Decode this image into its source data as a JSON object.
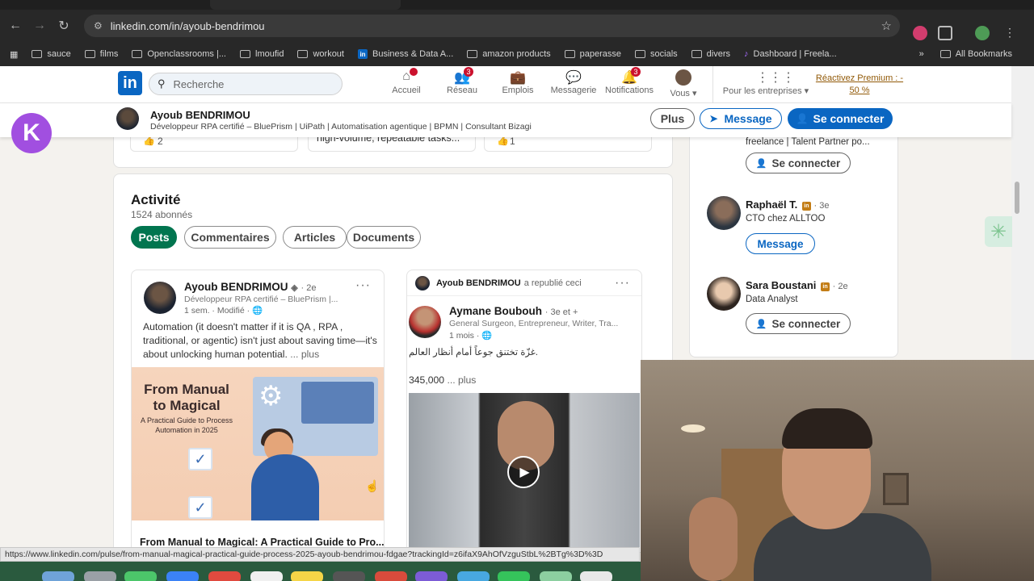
{
  "browser": {
    "url": "linkedin.com/in/ayoub-bendrimou",
    "bookmarks": [
      "sauce",
      "films",
      "Openclassrooms |...",
      "lmoufid",
      "workout",
      "Business & Data A...",
      "amazon products",
      "paperasse",
      "socials",
      "divers",
      "Dashboard | Freela..."
    ],
    "all_bookmarks": "All Bookmarks",
    "status_url": "https://www.linkedin.com/pulse/from-manual-magical-practical-guide-process-2025-ayoub-bendrimou-fdgae?trackingId=z6ifaX9AhOfVzguStbL%2BTg%3D%3D"
  },
  "header": {
    "logo": "in",
    "search_placeholder": "Recherche",
    "nav": [
      {
        "label": "Accueil",
        "badge": ""
      },
      {
        "label": "Réseau",
        "badge": "3"
      },
      {
        "label": "Emplois",
        "badge": ""
      },
      {
        "label": "Messagerie",
        "badge": ""
      },
      {
        "label": "Notifications",
        "badge": "3"
      },
      {
        "label": "Vous ▾",
        "badge": ""
      }
    ],
    "business": "Pour les entreprises ▾",
    "premium_line1": "Réactivez Premium : -",
    "premium_line2": "50 %"
  },
  "sticky": {
    "name": "Ayoub BENDRIMOU",
    "headline": "Développeur RPA certifié – BluePrism | UiPath | Automatisation agentique | BPMN | Consultant Bizagi",
    "plus": "Plus",
    "message": "Message",
    "connect": "Se connecter"
  },
  "kapp": "K",
  "strip": {
    "left_count": "2",
    "mid_text": "high-volume, repeatable tasks...",
    "right_count": "1"
  },
  "activity": {
    "title": "Activité",
    "followers": "1524 abonnés",
    "tabs": [
      "Posts",
      "Commentaires",
      "Articles",
      "Documents"
    ]
  },
  "post1": {
    "name": "Ayoub BENDRIMOU",
    "degree": "· 2e",
    "sub": "Développeur RPA certifié – BluePrism |...",
    "meta": "1 sem. · Modifié ·",
    "text": "Automation (it doesn't matter if it is QA , RPA , traditional, or agentic) isn't just about saving time—it's about unlocking human potential.",
    "more": "... plus",
    "img_title": "From Manual to Magical",
    "img_sub": "A Practical Guide to Process Automation in 2025",
    "caption": "From Manual to Magical: A Practical Guide to Pro..."
  },
  "post2": {
    "reposter": "Ayoub BENDRIMOU",
    "repost_label": "a republié ceci",
    "name": "Aymane Boubouh",
    "degree": "· 3e et +",
    "sub": "General Surgeon, Entrepreneur, Writer, Tra...",
    "meta": "1 mois ·",
    "text": "غزّة تختنق جوعاً أمام أنظار العالم.",
    "count": "345,000",
    "more": "... plus"
  },
  "sidebar": {
    "top_text": "freelance | Talent Partner po...",
    "connect": "Se connecter",
    "people": [
      {
        "name": "Raphaël T.",
        "degree": "· 3e",
        "role": "CTO chez ALLTOO",
        "action": "Message"
      },
      {
        "name": "Sara Boustani",
        "degree": "· 2e",
        "role": "Data Analyst",
        "action": "Se connecter"
      }
    ]
  },
  "colors": {
    "linkedin_blue": "#0a66c2",
    "active_tab": "#01754f",
    "badge": "#cb112d"
  }
}
